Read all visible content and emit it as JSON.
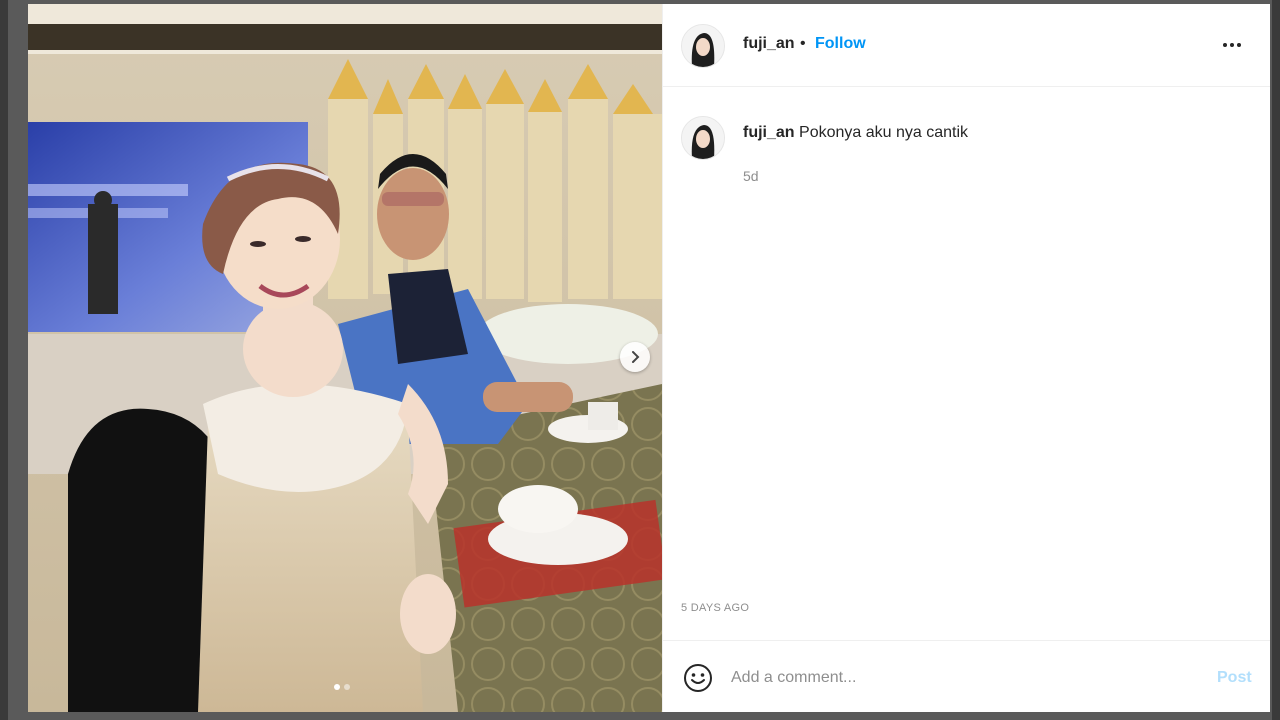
{
  "post": {
    "username": "fuji_an",
    "separator": "•",
    "follow_label": "Follow",
    "caption_user": "fuji_an",
    "caption_text": "Pokonya aku nya cantik",
    "caption_time": "5d",
    "date_ago": "5 DAYS AGO"
  },
  "comment": {
    "placeholder": "Add a comment...",
    "post_label": "Post"
  },
  "carousel": {
    "current": 1,
    "total": 2
  },
  "colors": {
    "accent": "#0095f6",
    "post_disabled": "#b2dffc",
    "text": "#262626",
    "muted": "#8e8e8e"
  },
  "icons": {
    "more": "more-horizontal-icon",
    "emoji": "emoji-smile-icon",
    "next": "chevron-right-icon"
  }
}
